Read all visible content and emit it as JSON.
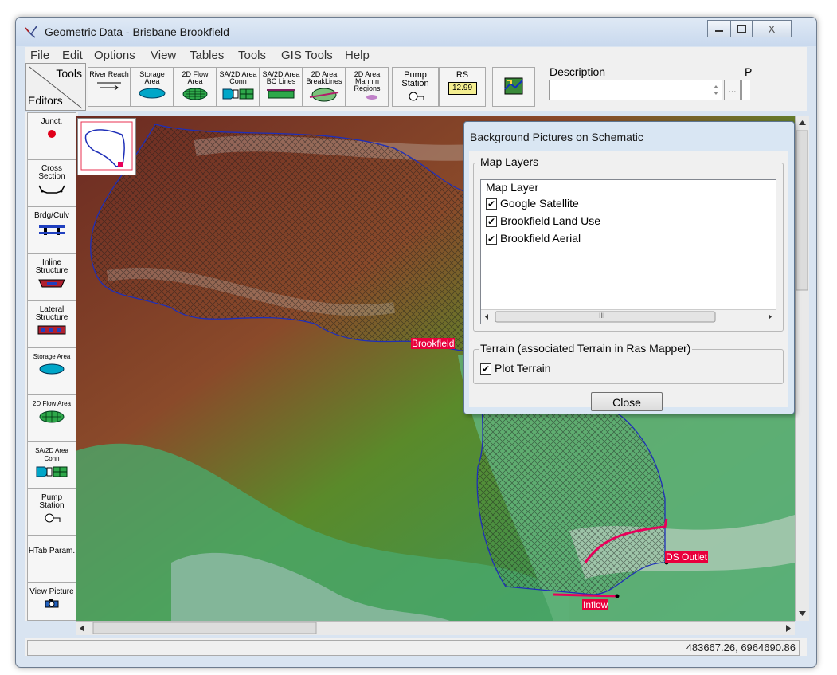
{
  "window": {
    "title": "Geometric Data - Brisbane Brookfield",
    "controls": {
      "minimize": "—",
      "maximize": "□",
      "close": "X"
    }
  },
  "menu": [
    "File",
    "Edit",
    "Options",
    "View",
    "Tables",
    "Tools",
    "GIS Tools",
    "Help"
  ],
  "toolbar": {
    "tools_label": "Tools",
    "editors_label": "Editors",
    "buttons": [
      {
        "label": "River Reach",
        "icon": "river-reach-icon"
      },
      {
        "label": "Storage Area",
        "icon": "storage-area-icon"
      },
      {
        "label": "2D Flow Area",
        "icon": "2d-flow-area-icon"
      },
      {
        "label": "SA/2D Area Conn",
        "icon": "sa-2d-conn-icon"
      },
      {
        "label": "SA/2D Area BC Lines",
        "icon": "bc-lines-icon"
      },
      {
        "label": "2D Area BreakLines",
        "icon": "breaklines-icon"
      },
      {
        "label": "2D Area Mann n Regions",
        "icon": "mann-n-icon"
      },
      {
        "label": "Pump Station",
        "icon": "pump-station-icon"
      },
      {
        "label": "RS",
        "icon": "rs-icon",
        "value": "12.99"
      }
    ],
    "description_label": "Description",
    "description_value": "",
    "ellipsis": "...",
    "cut_label": "P"
  },
  "left_tools": [
    {
      "label": "Junct.",
      "icon": "junction-icon"
    },
    {
      "label": "Cross Section",
      "icon": "cross-section-icon"
    },
    {
      "label": "Brdg/Culv",
      "icon": "bridge-culvert-icon"
    },
    {
      "label": "Inline Structure",
      "icon": "inline-structure-icon"
    },
    {
      "label": "Lateral Structure",
      "icon": "lateral-structure-icon"
    },
    {
      "label": "Storage Area",
      "icon": "storage-area-icon"
    },
    {
      "label": "2D Flow Area",
      "icon": "2d-flow-area-icon"
    },
    {
      "label": "SA/2D Area Conn",
      "icon": "sa-2d-conn-icon"
    },
    {
      "label": "Pump Station",
      "icon": "pump-station-icon"
    },
    {
      "label": "HTab Param.",
      "icon": ""
    },
    {
      "label": "View Picture",
      "icon": "camera-icon"
    }
  ],
  "map": {
    "labels": {
      "brookfield": "Brookfield",
      "ds_outlet": "DS Outlet",
      "inflow": "Inflow"
    }
  },
  "dialog": {
    "title": "Background Pictures on Schematic",
    "map_layers_group": "Map Layers",
    "column_header": "Map Layer",
    "layers": [
      {
        "name": "Google Satellite",
        "checked": true
      },
      {
        "name": "Brookfield Land Use",
        "checked": true
      },
      {
        "name": "Brookfield Aerial",
        "checked": true
      }
    ],
    "scroll_thumb": "III",
    "terrain_group": "Terrain (associated Terrain in Ras Mapper)",
    "plot_terrain_label": "Plot Terrain",
    "plot_terrain_checked": true,
    "close_label": "Close"
  },
  "status": {
    "coords": "483667.26, 6964690.86"
  },
  "colors": {
    "highlight": "#e8003c",
    "boundary": "#1f2fb8",
    "titlebar": "#d9e4f1"
  }
}
